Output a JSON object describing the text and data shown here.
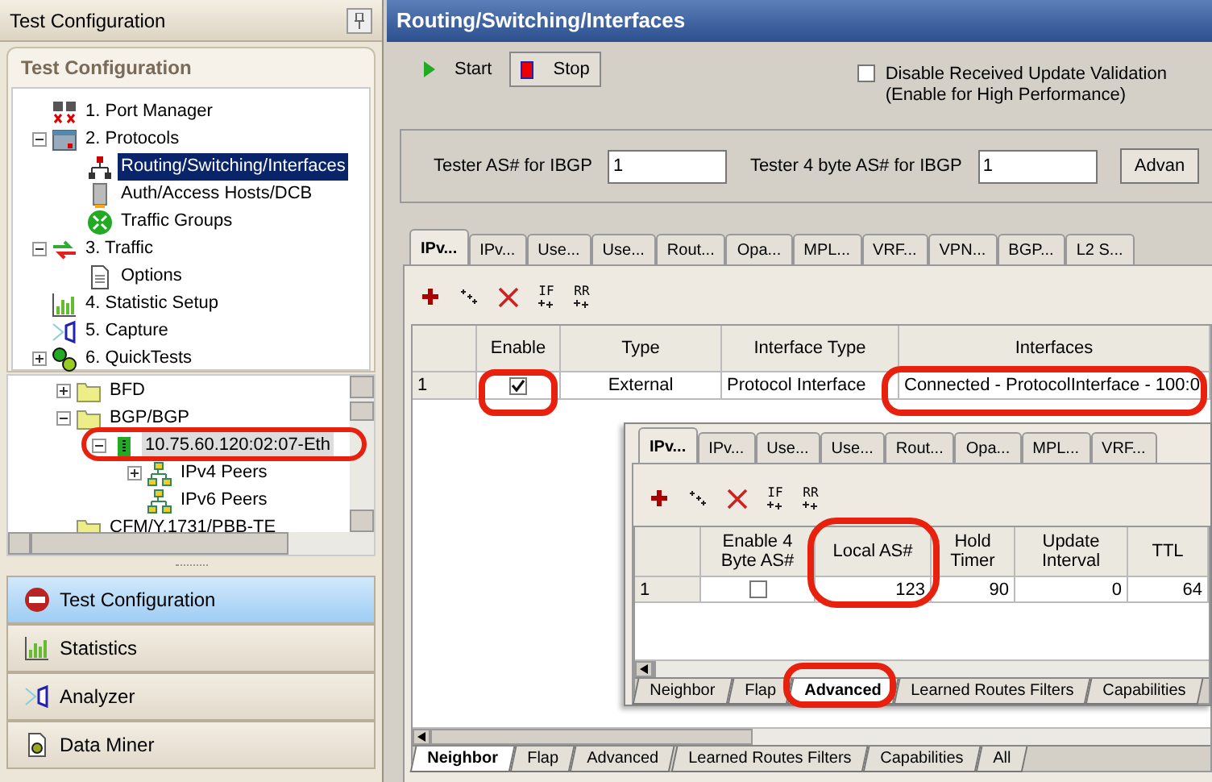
{
  "left_panel": {
    "title": "Test Configuration",
    "section_title": "Test Configuration",
    "tree": [
      {
        "label": "1. Port Manager",
        "kind": "port-manager",
        "selected": false
      },
      {
        "label": "2. Protocols",
        "kind": "protocols",
        "expanded": true,
        "selected": false,
        "children": [
          {
            "label": "Routing/Switching/Interfaces",
            "kind": "network",
            "selected": true
          },
          {
            "label": "Auth/Access Hosts/DCB",
            "kind": "host",
            "selected": false
          },
          {
            "label": "Traffic Groups",
            "kind": "traffic-groups",
            "selected": false
          }
        ]
      },
      {
        "label": "3. Traffic",
        "kind": "traffic",
        "expanded": true,
        "selected": false,
        "children": [
          {
            "label": "Options",
            "kind": "document",
            "selected": false
          }
        ]
      },
      {
        "label": "4. Statistic Setup",
        "kind": "chart",
        "selected": false
      },
      {
        "label": "5. Capture",
        "kind": "capture",
        "selected": false
      },
      {
        "label": "6. QuickTests",
        "kind": "quicktests",
        "expanded": false,
        "selected": false
      }
    ],
    "protocol_tree": [
      {
        "label": "BFD",
        "kind": "folder",
        "expanded": false,
        "selected": false
      },
      {
        "label": "BGP/BGP",
        "kind": "folder",
        "expanded": true,
        "selected": false,
        "children": [
          {
            "label": "10.75.60.120:02:07-Eth",
            "kind": "port",
            "expanded": true,
            "selected": true,
            "children": [
              {
                "label": "IPv4 Peers",
                "kind": "peers",
                "expanded": false,
                "selected": false
              },
              {
                "label": "IPv6 Peers",
                "kind": "peers",
                "selected": false
              }
            ]
          }
        ]
      },
      {
        "label": "CFM/Y.1731/PBB-TE",
        "kind": "folder",
        "selected": false
      }
    ],
    "nav": [
      {
        "label": "Test Configuration",
        "kind": "config",
        "selected": true
      },
      {
        "label": "Statistics",
        "kind": "chart",
        "selected": false
      },
      {
        "label": "Analyzer",
        "kind": "capture",
        "selected": false
      },
      {
        "label": "Data Miner",
        "kind": "miner",
        "selected": false
      }
    ]
  },
  "main": {
    "title": "Routing/Switching/Interfaces",
    "controls": [
      {
        "label": "Start",
        "kind": "start",
        "selected": false
      },
      {
        "label": "Stop",
        "kind": "stop",
        "selected": true
      }
    ],
    "disable_validation": {
      "label": "Disable Received Update Validation",
      "note": "(Enable for High Performance)",
      "checked": false
    },
    "fields": [
      {
        "label": "Tester AS# for IBGP",
        "value": "1"
      },
      {
        "label": "Tester 4 byte AS# for IBGP",
        "value": "1"
      }
    ],
    "advanced_button": "Advan",
    "tabs": [
      {
        "label": "IPv...",
        "selected": true
      },
      {
        "label": "IPv...",
        "selected": false
      },
      {
        "label": "Use...",
        "selected": false
      },
      {
        "label": "Use...",
        "selected": false
      },
      {
        "label": "Rout...",
        "selected": false
      },
      {
        "label": "Opa...",
        "selected": false
      },
      {
        "label": "MPL...",
        "selected": false
      },
      {
        "label": "VRF...",
        "selected": false
      },
      {
        "label": "VPN...",
        "selected": false
      },
      {
        "label": "BGP...",
        "selected": false
      },
      {
        "label": "L2 S...",
        "selected": false
      }
    ],
    "toolbar": [
      {
        "kind": "add"
      },
      {
        "kind": "add-multiple"
      },
      {
        "kind": "delete"
      },
      {
        "kind": "labeled",
        "label": "IF"
      },
      {
        "kind": "labeled",
        "label": "RR"
      }
    ],
    "table": {
      "columns": [
        "Enable",
        "Type",
        "Interface Type",
        "Interfaces"
      ],
      "rows": [
        {
          "number": "1",
          "enable": true,
          "type": "External",
          "interface_type": "Protocol Interface",
          "interfaces": "Connected - ProtocolInterface - 100:0"
        }
      ]
    },
    "bottom_tabs": [
      {
        "label": "Neighbor",
        "selected": true
      },
      {
        "label": "Flap",
        "selected": false
      },
      {
        "label": "Advanced",
        "selected": false
      },
      {
        "label": "Learned Routes Filters",
        "selected": false
      },
      {
        "label": "Capabilities",
        "selected": false
      },
      {
        "label": "All",
        "selected": false
      }
    ]
  },
  "inset": {
    "tabs": [
      {
        "label": "IPv...",
        "selected": true
      },
      {
        "label": "IPv...",
        "selected": false
      },
      {
        "label": "Use...",
        "selected": false
      },
      {
        "label": "Use...",
        "selected": false
      },
      {
        "label": "Rout...",
        "selected": false
      },
      {
        "label": "Opa...",
        "selected": false
      },
      {
        "label": "MPL...",
        "selected": false
      },
      {
        "label": "VRF...",
        "selected": false
      }
    ],
    "toolbar": [
      {
        "kind": "add"
      },
      {
        "kind": "add-multiple"
      },
      {
        "kind": "delete"
      },
      {
        "kind": "labeled",
        "label": "IF"
      },
      {
        "kind": "labeled",
        "label": "RR"
      }
    ],
    "table": {
      "columns": [
        "Enable 4 Byte AS#",
        "Local AS#",
        "Hold Timer",
        "Update Interval",
        "TTL"
      ],
      "rows": [
        {
          "number": "1",
          "enable_4_byte": false,
          "local_as": "123",
          "hold_timer": "90",
          "update_interval": "0",
          "ttl": "64"
        }
      ]
    },
    "bottom_tabs": [
      {
        "label": "Neighbor",
        "selected": false
      },
      {
        "label": "Flap",
        "selected": false
      },
      {
        "label": "Advanced",
        "selected": true
      },
      {
        "label": "Learned Routes Filters",
        "selected": false
      },
      {
        "label": "Capabilities",
        "selected": false
      }
    ]
  }
}
